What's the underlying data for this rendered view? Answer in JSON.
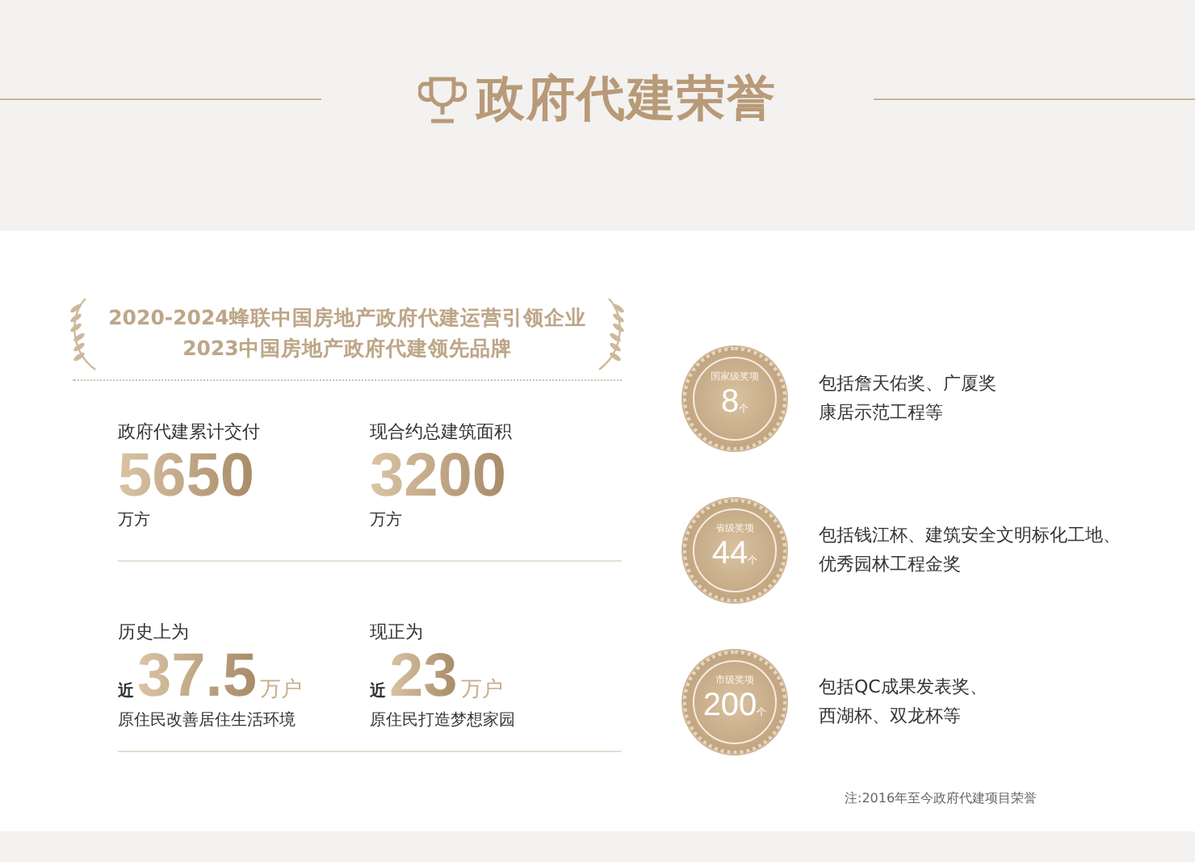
{
  "title": "政府代建荣誉",
  "honor_banner": {
    "lines": [
      "2020-2024蜂联中国房地产政府代建运营引领企业",
      "2023中国房地产政府代建领先品牌"
    ]
  },
  "stats": [
    {
      "label": "政府代建累计交付",
      "value": "5650",
      "unit": "万方"
    },
    {
      "label": "现合约总建筑面积",
      "value": "3200",
      "unit": "万方"
    },
    {
      "label": "历史上为",
      "prefix": "近",
      "value": "37.5",
      "unit_inline": "万户",
      "unit": "原住民改善居住生活环境"
    },
    {
      "label": "现正为",
      "prefix": "近",
      "value": "23",
      "unit_inline": "万户",
      "unit": "原住民打造梦想家园"
    }
  ],
  "awards": [
    {
      "level": "国家级奖项",
      "count": "8",
      "suffix": "个",
      "lines": [
        "包括詹天佑奖、广厦奖",
        "康居示范工程等"
      ]
    },
    {
      "level": "省级奖项",
      "count": "44",
      "suffix": "个",
      "lines": [
        "包括钱江杯、建筑安全文明标化工地、",
        "优秀园林工程金奖"
      ]
    },
    {
      "level": "市级奖项",
      "count": "200",
      "suffix": "个",
      "lines": [
        "包括QC成果发表奖、",
        "西湖杯、双龙杯等"
      ]
    }
  ],
  "note": "注:2016年至今政府代建项目荣誉"
}
